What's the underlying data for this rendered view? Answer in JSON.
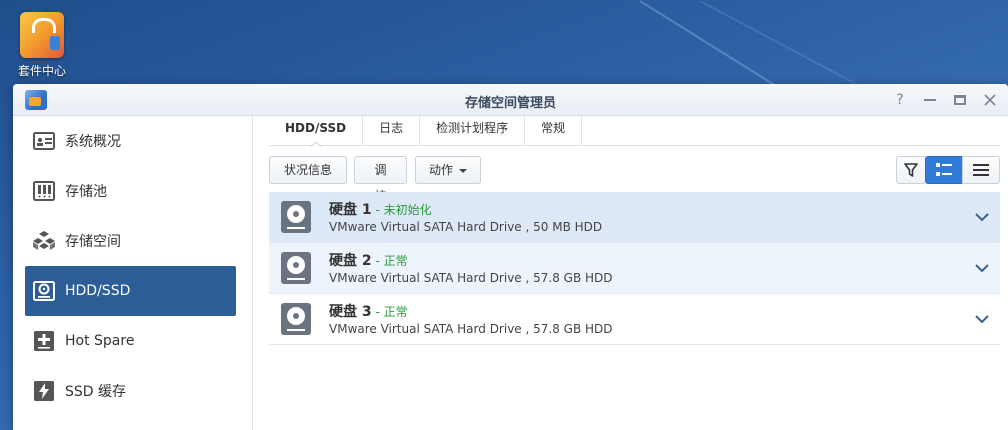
{
  "desktop": {
    "icon_label": "套件中心"
  },
  "window": {
    "title": "存储空间管理员",
    "help_symbol": "?"
  },
  "sidebar": {
    "items": [
      {
        "label": "系统概况",
        "icon": "overview-icon"
      },
      {
        "label": "存储池",
        "icon": "storage-pool-icon"
      },
      {
        "label": "存储空间",
        "icon": "volume-icon"
      },
      {
        "label": "HDD/SSD",
        "icon": "hdd-icon",
        "active": true
      },
      {
        "label": "Hot Spare",
        "icon": "hot-spare-icon"
      },
      {
        "label": "SSD 缓存",
        "icon": "ssd-cache-icon"
      }
    ]
  },
  "tabs": [
    {
      "label": "HDD/SSD",
      "active": true
    },
    {
      "label": "日志"
    },
    {
      "label": "检测计划程序"
    },
    {
      "label": "常规"
    }
  ],
  "toolbar": {
    "status_label": "状况信息",
    "calibrate_label": "调校",
    "action_label": "动作"
  },
  "disks": [
    {
      "name": "硬盘 1",
      "status": " - 未初始化",
      "desc": "VMware Virtual SATA Hard Drive , 50 MB HDD"
    },
    {
      "name": "硬盘 2",
      "status": " - 正常",
      "desc": "VMware Virtual SATA Hard Drive , 57.8 GB HDD"
    },
    {
      "name": "硬盘 3",
      "status": " - 正常",
      "desc": "VMware Virtual SATA Hard Drive , 57.8 GB HDD"
    }
  ],
  "colors": {
    "accent": "#2c5d96",
    "status_green": "#2a9a3b",
    "selected_row": "#dde9f7"
  }
}
